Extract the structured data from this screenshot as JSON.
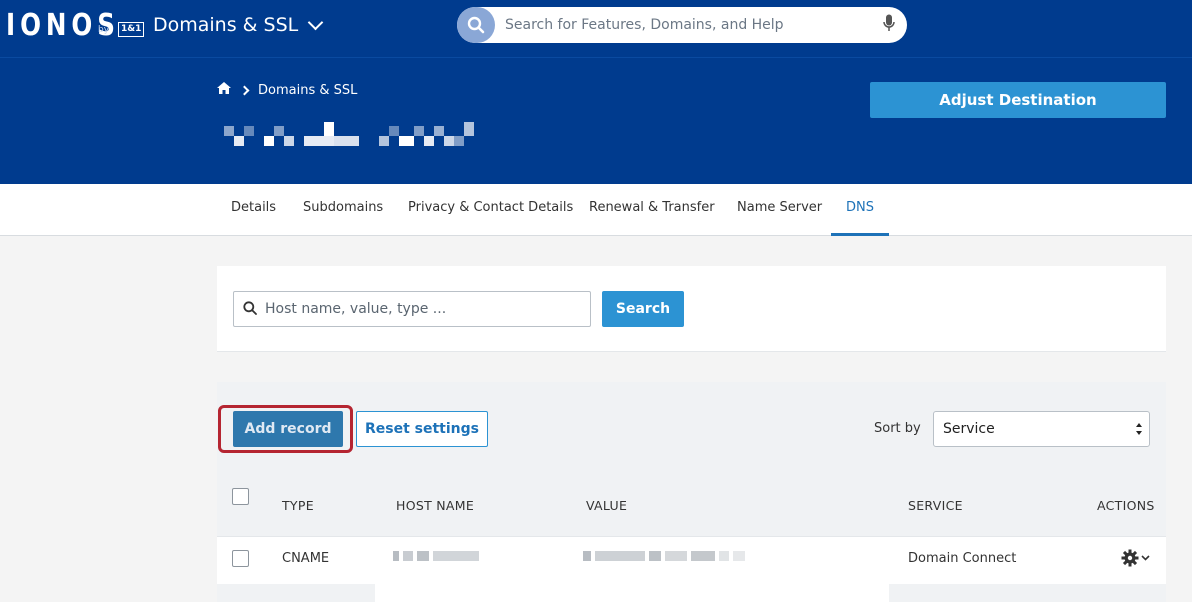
{
  "topbar": {
    "logo_text": "IONOS",
    "logo_by": "by",
    "logo_badge": "1&1",
    "app_title": "Domains & SSL",
    "search_placeholder": "Search for Features, Domains, and Help"
  },
  "header": {
    "breadcrumb": "Domains & SSL",
    "adjust_button": "Adjust Destination"
  },
  "tabs": [
    {
      "label": "Details",
      "active": false
    },
    {
      "label": "Subdomains",
      "active": false
    },
    {
      "label": "Privacy & Contact Details",
      "active": false
    },
    {
      "label": "Renewal & Transfer",
      "active": false
    },
    {
      "label": "Name Server",
      "active": false
    },
    {
      "label": "DNS",
      "active": true
    }
  ],
  "filter": {
    "placeholder": "Host name, value, type ...",
    "search_button": "Search"
  },
  "records": {
    "add_button": "Add record",
    "reset_button": "Reset settings",
    "sort_label": "Sort by",
    "sort_value": "Service",
    "columns": [
      "TYPE",
      "HOST NAME",
      "VALUE",
      "SERVICE",
      "ACTIONS"
    ],
    "rows": [
      {
        "type": "CNAME",
        "service": "Domain Connect"
      }
    ]
  },
  "colors": {
    "brand_blue": "#003b8e",
    "action_blue": "#2c93d3",
    "highlight_red": "#b52531"
  }
}
